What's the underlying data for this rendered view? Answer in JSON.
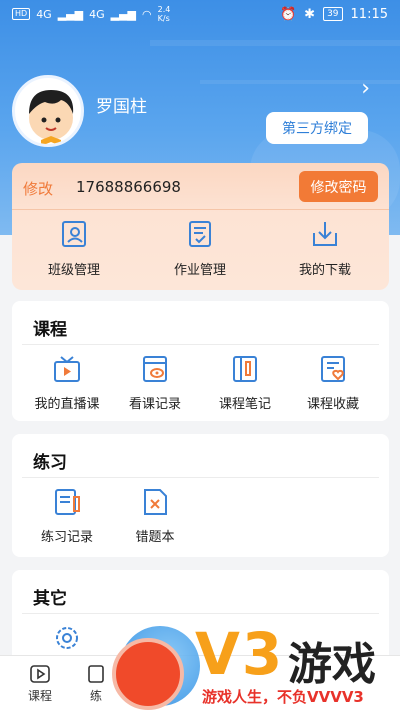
{
  "status_bar": {
    "left_badges": [
      "HD",
      "HD"
    ],
    "network_left": "4G",
    "network_right": "4G",
    "speed_value": "2.4",
    "speed_unit": "K/s",
    "battery": "39",
    "time": "11:15"
  },
  "profile": {
    "name": "罗国柱",
    "bind_button": "第三方绑定",
    "chevron": "›"
  },
  "account": {
    "edit_label": "修改",
    "phone": "17688866698",
    "change_password": "修改密码"
  },
  "quick_actions": [
    {
      "label": "班级管理",
      "icon": "class-management-icon"
    },
    {
      "label": "作业管理",
      "icon": "homework-management-icon"
    },
    {
      "label": "我的下载",
      "icon": "download-icon"
    }
  ],
  "courses": {
    "title": "课程",
    "items": [
      {
        "label": "我的直播课",
        "icon": "live-tv-icon"
      },
      {
        "label": "看课记录",
        "icon": "watch-history-icon"
      },
      {
        "label": "课程笔记",
        "icon": "notes-icon"
      },
      {
        "label": "课程收藏",
        "icon": "favorites-icon"
      }
    ]
  },
  "practice": {
    "title": "练习",
    "items": [
      {
        "label": "练习记录",
        "icon": "practice-record-icon"
      },
      {
        "label": "错题本",
        "icon": "wrong-questions-icon"
      }
    ]
  },
  "other": {
    "title": "其它",
    "items": [
      {
        "label": "",
        "icon": "settings-icon"
      }
    ]
  },
  "tabbar": {
    "tabs": [
      {
        "label": "课程",
        "icon": "play-icon"
      },
      {
        "label": "练",
        "icon": "practice-icon"
      }
    ]
  },
  "watermark": {
    "brand": "V3",
    "brand_cn": "游戏",
    "slogan": "游戏人生，不负VVVV3"
  },
  "colors": {
    "header_blue": "#3d8fe6",
    "accent_blue": "#2f7fd8",
    "accent_orange": "#f27a36"
  }
}
